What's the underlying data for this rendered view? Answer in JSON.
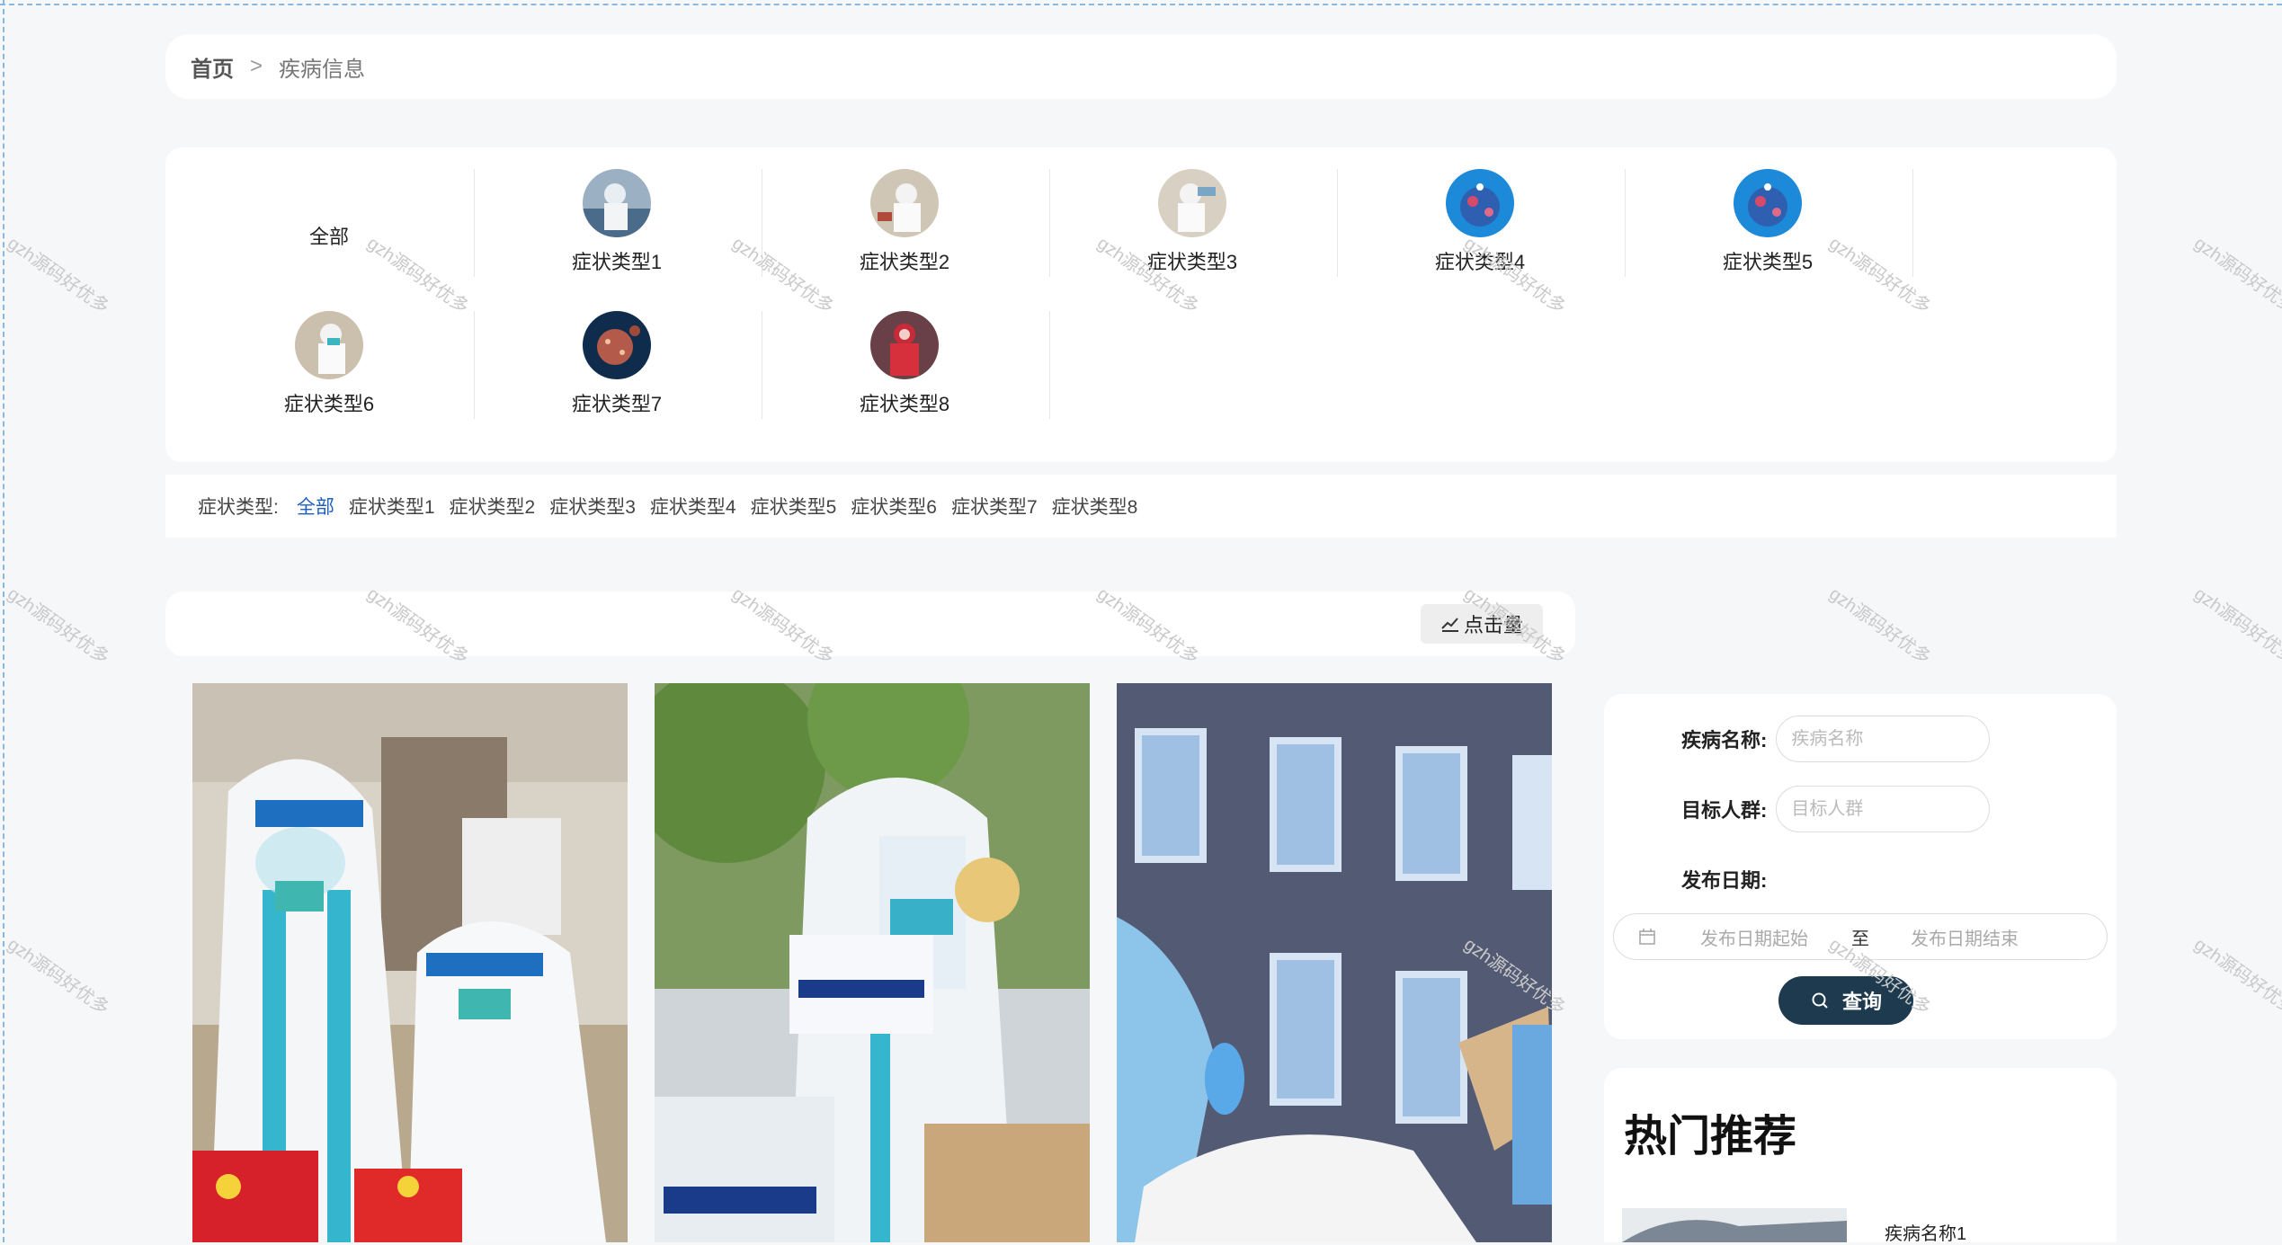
{
  "breadcrumb": {
    "home": "首页",
    "separator": ">",
    "current": "疾病信息"
  },
  "categories": [
    {
      "label": "全部",
      "icon": "none"
    },
    {
      "label": "症状类型1",
      "icon": "medical-staff-photo"
    },
    {
      "label": "症状类型2",
      "icon": "medical-staff-photo"
    },
    {
      "label": "症状类型3",
      "icon": "medical-staff-photo"
    },
    {
      "label": "症状类型4",
      "icon": "virus-globe-photo"
    },
    {
      "label": "症状类型5",
      "icon": "virus-globe-photo"
    },
    {
      "label": "症状类型6",
      "icon": "medical-staff-photo"
    },
    {
      "label": "症状类型7",
      "icon": "virus-photo"
    },
    {
      "label": "症状类型8",
      "icon": "medical-staff-red-photo"
    }
  ],
  "filter": {
    "label": "症状类型:",
    "options": [
      "全部",
      "症状类型1",
      "症状类型2",
      "症状类型3",
      "症状类型4",
      "症状类型5",
      "症状类型6",
      "症状类型7",
      "症状类型8"
    ],
    "active": "全部"
  },
  "sort": {
    "label": "点击量",
    "icon": "trend-icon"
  },
  "search": {
    "name_label": "疾病名称:",
    "name_placeholder": "疾病名称",
    "crowd_label": "目标人群:",
    "crowd_placeholder": "目标人群",
    "date_label": "发布日期:",
    "date_start_placeholder": "发布日期起始",
    "date_to": "至",
    "date_end_placeholder": "发布日期结束",
    "button": "查询"
  },
  "hot": {
    "title": "热门推荐",
    "first_item": "疾病名称1"
  },
  "watermark": "gzh源码好优多",
  "colors": {
    "accent": "#1f5fbf",
    "button_dark": "#1d3a4f",
    "page_bg": "#f6f7f9"
  }
}
